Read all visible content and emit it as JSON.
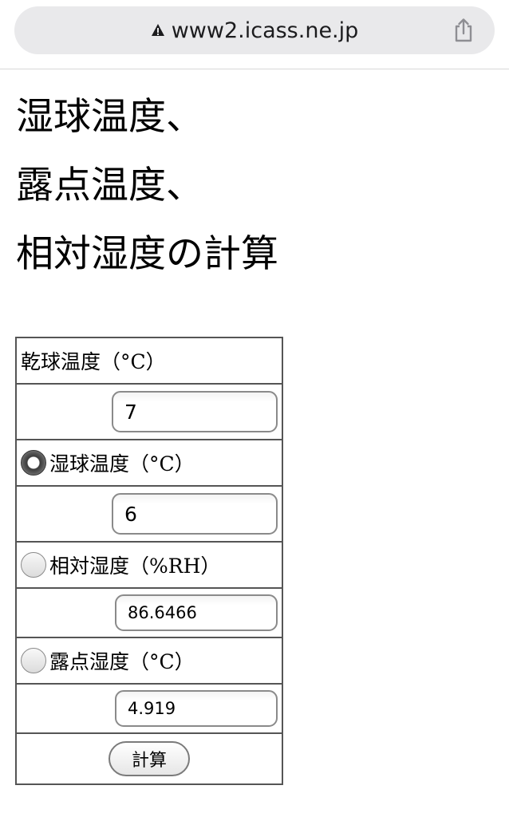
{
  "browser": {
    "url": "www2.icass.ne.jp",
    "security_icon": "warning-triangle-icon",
    "share_icon": "share-icon"
  },
  "page": {
    "title_lines": [
      "湿球温度、",
      "露点温度、",
      "相対湿度の計算"
    ]
  },
  "form": {
    "dry_bulb": {
      "label": "乾球温度（°C）",
      "value": "7"
    },
    "wet_bulb": {
      "label": "湿球温度（°C）",
      "value": "6",
      "selected": true
    },
    "relative_humidity": {
      "label": "相対湿度（%RH）",
      "value": "86.6466",
      "selected": false
    },
    "dew_point": {
      "label": "露点湿度（°C）",
      "value": "4.919",
      "selected": false
    },
    "calc_button_label": "計算"
  }
}
